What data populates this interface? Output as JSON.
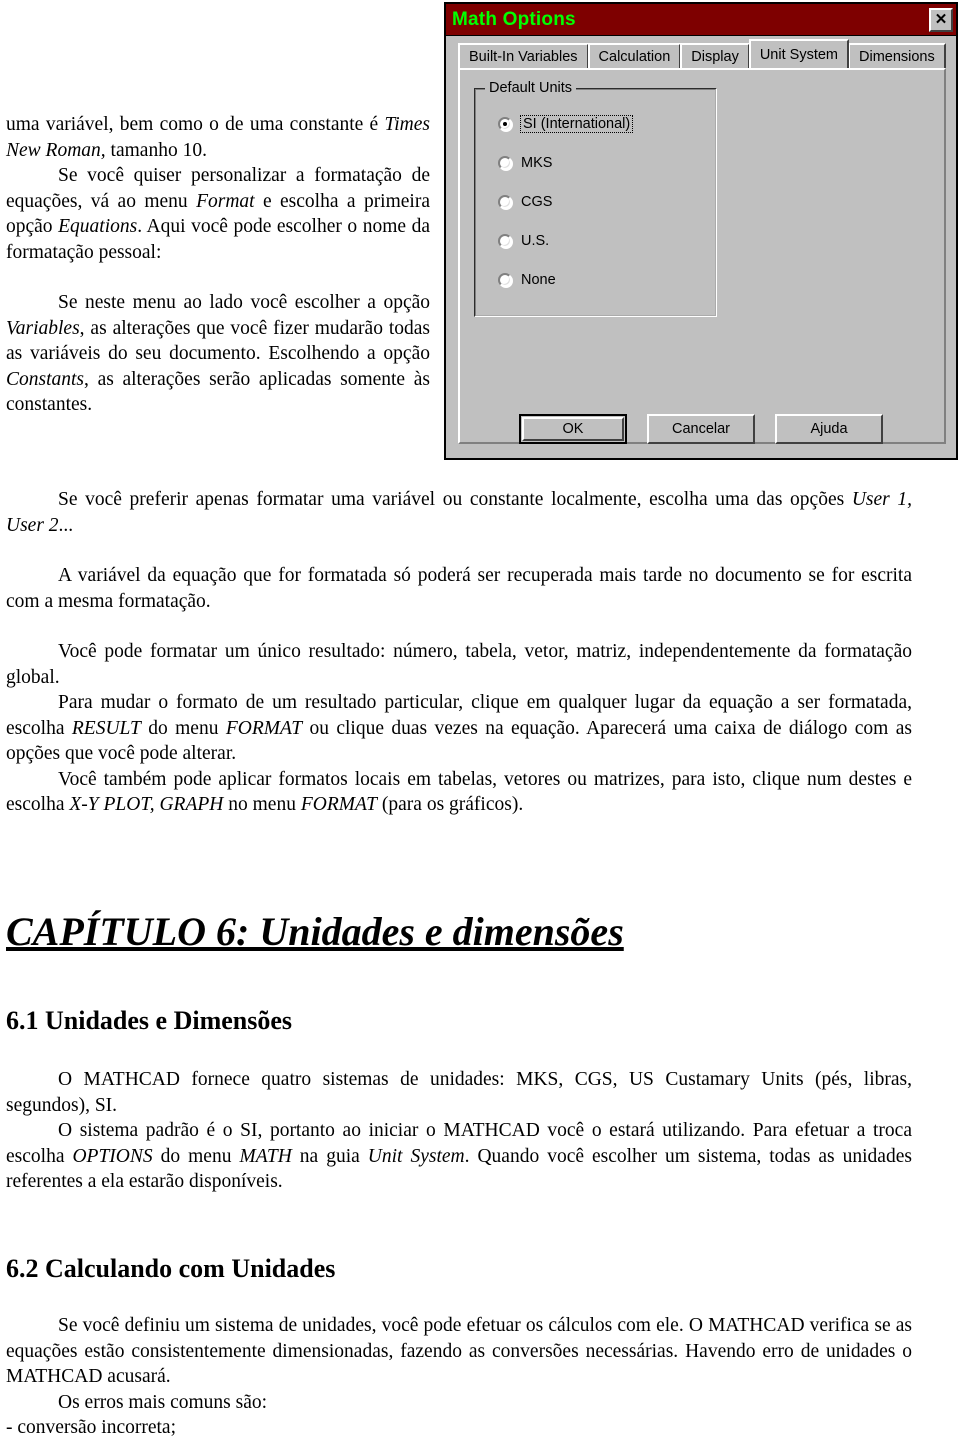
{
  "dialog": {
    "title": "Math Options",
    "close_label": "✕",
    "tabs": [
      {
        "label": "Built-In Variables",
        "active": false
      },
      {
        "label": "Calculation",
        "active": false
      },
      {
        "label": "Display",
        "active": false
      },
      {
        "label": "Unit System",
        "active": true
      },
      {
        "label": "Dimensions",
        "active": false
      }
    ],
    "group_label": "Default Units",
    "options": [
      {
        "label": "SI (International)",
        "checked": true
      },
      {
        "label": "MKS",
        "checked": false
      },
      {
        "label": "CGS",
        "checked": false
      },
      {
        "label": "U.S.",
        "checked": false
      },
      {
        "label": "None",
        "checked": false
      }
    ],
    "buttons": [
      {
        "label": "OK",
        "default": true
      },
      {
        "label": "Cancelar",
        "default": false
      },
      {
        "label": "Ajuda",
        "default": false
      }
    ]
  },
  "document": {
    "top": {
      "p1_a": "uma variável, bem como o de uma constante é ",
      "p1_i": "Times New Roman,",
      "p1_b": " tamanho 10.",
      "p2_a": "Se você quiser personalizar a formatação de equações, vá ao menu ",
      "p2_i1": "Format",
      "p2_b": " e escolha a primeira opção ",
      "p2_i2": "Equations",
      "p2_c": ". Aqui você pode escolher o nome da formatação pessoal:",
      "p3_a": "Se neste menu ao lado você escolher a opção ",
      "p3_i1": "Variables",
      "p3_b": ", as alterações que você fizer mudarão todas as variáveis do seu documento. Escolhendo a opção ",
      "p3_i2": "Constants",
      "p3_c": ", as alterações serão aplicadas somente às constantes."
    },
    "mid": {
      "p4_a": "Se você preferir apenas formatar uma variável ou constante localmente, escolha uma das opções ",
      "p4_i": "User 1, User 2",
      "p4_b": "...",
      "p5": "A variável da equação que for formatada só poderá ser recuperada mais tarde no documento se for escrita com a mesma formatação.",
      "p6": "Você pode formatar um único resultado: número, tabela, vetor, matriz, independentemente da formatação global.",
      "p7_a": "Para mudar o formato de um resultado particular, clique em qualquer lugar da equação a ser formatada, escolha ",
      "p7_i1": "RESULT",
      "p7_b": " do menu ",
      "p7_i2": "FORMAT",
      "p7_c": " ou clique duas vezes na equação. Aparecerá uma caixa de diálogo com as opções que você pode alterar.",
      "p8_a": "Você também pode aplicar formatos locais em tabelas, vetores ou matrizes, para isto, clique num destes e escolha ",
      "p8_i1": "X-Y PLOT, GRAPH",
      "p8_b": " no menu ",
      "p8_i2": "FORMAT",
      "p8_c": " (para os gráficos)."
    },
    "chapter_title": "CAPÍTULO 6: Unidades e dimensões",
    "section_61": "6.1 Unidades e Dimensões",
    "block_61": {
      "p1": "O MATHCAD fornece quatro sistemas de unidades: MKS, CGS, US Custamary Units (pés, libras, segundos), SI.",
      "p2_a": "O sistema padrão é o SI, portanto ao iniciar o MATHCAD você o estará utilizando. Para efetuar a troca escolha ",
      "p2_i1": "OPTIONS",
      "p2_b": " do menu ",
      "p2_i2": "MATH",
      "p2_c": " na guia ",
      "p2_i3": "Unit System",
      "p2_d": ". Quando você escolher um sistema, todas as unidades referentes a ela estarão disponíveis."
    },
    "section_62": "6.2 Calculando com Unidades",
    "block_62": {
      "p1": "Se você definiu um sistema de unidades, você pode efetuar os cálculos com ele. O MATHCAD verifica se as equações estão consistentemente dimensionadas, fazendo as conversões necessárias. Havendo erro de unidades o MATHCAD acusará.",
      "p2": "Os erros mais comuns são:",
      "p3": "- conversão incorreta;"
    }
  }
}
